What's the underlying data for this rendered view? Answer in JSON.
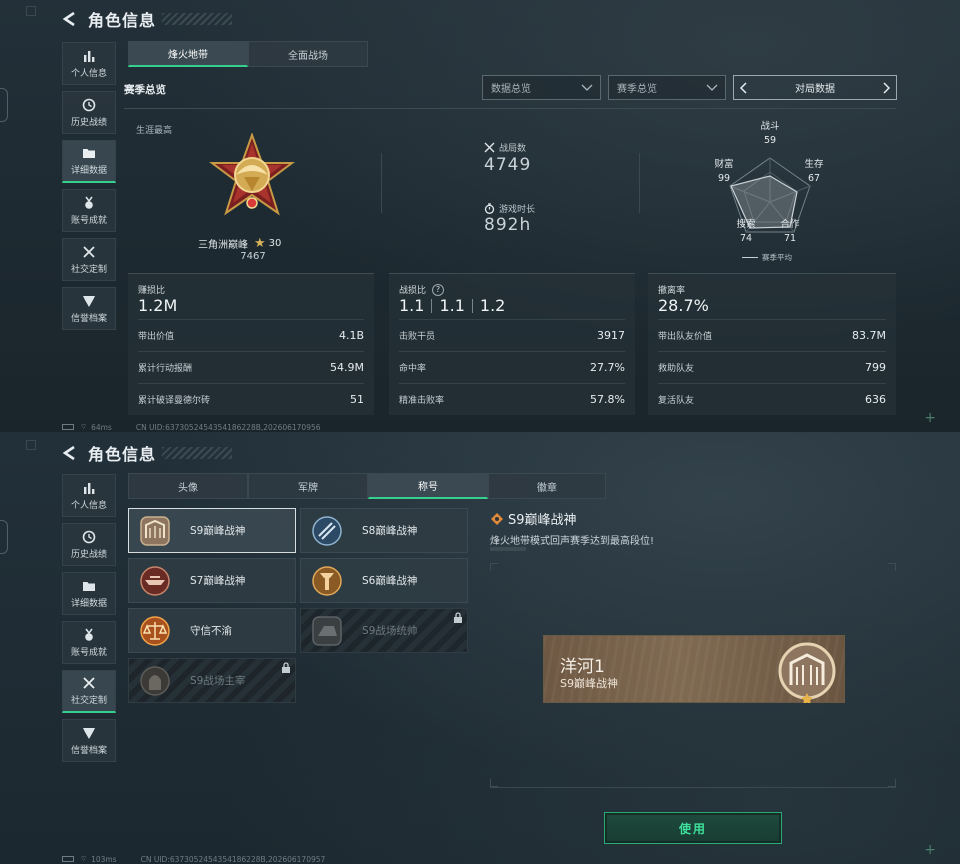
{
  "header": {
    "title": "角色信息"
  },
  "sidebar": {
    "items": [
      {
        "label": "个人信息"
      },
      {
        "label": "历史战绩"
      },
      {
        "label": "详细数据"
      },
      {
        "label": "账号成就"
      },
      {
        "label": "社交定制"
      },
      {
        "label": "信誉档案"
      }
    ]
  },
  "panel1": {
    "mode_tabs": [
      "烽火地带",
      "全面战场"
    ],
    "active_mode": "烽火地带",
    "section_title": "赛季总览",
    "dropdowns": [
      {
        "value": "数据总览"
      },
      {
        "value": "赛季总览"
      }
    ],
    "pager_label": "对局数据",
    "career_label": "生涯最高",
    "rank_name": "三角洲巅峰",
    "rank_stars": "30",
    "rank_score": "7467",
    "matches_label": "战局数",
    "matches_value": "4749",
    "playtime_label": "游戏时长",
    "playtime_value": "892h",
    "radar": {
      "axes": [
        {
          "name": "战斗",
          "value": "59"
        },
        {
          "name": "生存",
          "value": "67"
        },
        {
          "name": "合作",
          "value": "71"
        },
        {
          "name": "搜索",
          "value": "74"
        },
        {
          "name": "财富",
          "value": "99"
        }
      ],
      "legend": "赛季平均"
    },
    "cards": [
      {
        "label": "赚损比",
        "value": "1.2M",
        "rows": [
          {
            "label": "带出价值",
            "value": "4.1B"
          },
          {
            "label": "累计行动报酬",
            "value": "54.9M"
          },
          {
            "label": "累计破译曼德尔砖",
            "value": "51"
          }
        ]
      },
      {
        "label": "战损比",
        "help": "?",
        "values": [
          "1.1",
          "1.1",
          "1.2"
        ],
        "rows": [
          {
            "label": "击败干员",
            "value": "3917"
          },
          {
            "label": "命中率",
            "value": "27.7%"
          },
          {
            "label": "精准击败率",
            "value": "57.8%"
          }
        ]
      },
      {
        "label": "撤离率",
        "value": "28.7%",
        "rows": [
          {
            "label": "带出队友价值",
            "value": "83.7M"
          },
          {
            "label": "救助队友",
            "value": "799"
          },
          {
            "label": "复活队友",
            "value": "636"
          }
        ]
      }
    ],
    "status": {
      "ping": "64ms",
      "uid": "CN UID:6373052454354186228B,202606170956"
    }
  },
  "panel2": {
    "tabs": [
      "头像",
      "军牌",
      "称号",
      "徽章"
    ],
    "active_tab": "称号",
    "titles": [
      {
        "name": "S9巅峰战神",
        "selected": true,
        "locked": false
      },
      {
        "name": "S8巅峰战神",
        "selected": false,
        "locked": false
      },
      {
        "name": "S7巅峰战神",
        "selected": false,
        "locked": false
      },
      {
        "name": "S6巅峰战神",
        "selected": false,
        "locked": false
      },
      {
        "name": "守信不渝",
        "selected": false,
        "locked": false
      },
      {
        "name": "S9战场统帅",
        "selected": false,
        "locked": true
      },
      {
        "name": "S9战场主宰",
        "selected": false,
        "locked": true
      }
    ],
    "detail": {
      "title": "S9巅峰战神",
      "description": "烽火地带模式回声赛季达到最高段位!"
    },
    "nameplate": {
      "player": "洋河1",
      "title": "S9巅峰战神"
    },
    "use_button": "使用",
    "status": {
      "ping": "103ms",
      "uid": "CN UID:6373052454354186228B,202606170957"
    }
  },
  "colors": {
    "accent": "#35d08d",
    "panel": "#233039",
    "gold": "#d8b35a",
    "nameplate": "#7a644d"
  }
}
